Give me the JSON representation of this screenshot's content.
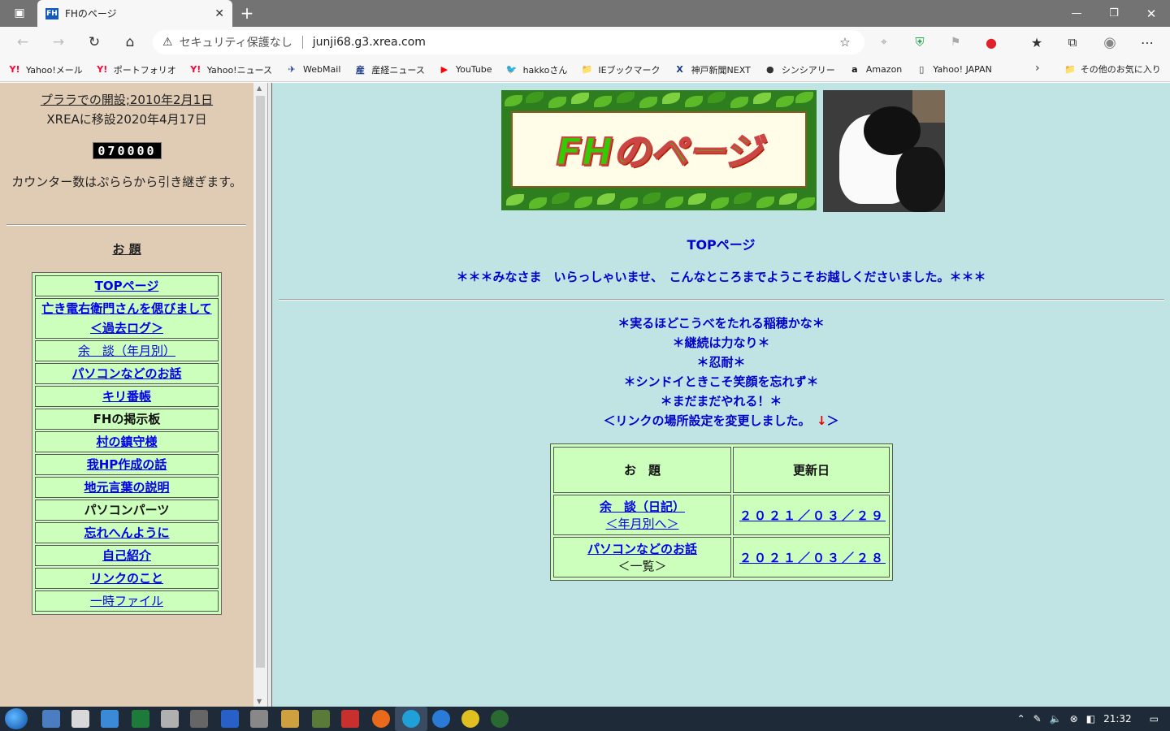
{
  "browser": {
    "tab_title": "FHのページ",
    "tab_favicon": "FH",
    "tab_close": "✕",
    "new_tab": "+",
    "security_text": "セキュリティ保護なし",
    "url": "junji68.g3.xrea.com",
    "bookmarks": [
      {
        "icon": "Y!",
        "color": "#ff0033",
        "label": "Yahoo!メール"
      },
      {
        "icon": "Y!",
        "color": "#ff0033",
        "label": "ポートフォリオ"
      },
      {
        "icon": "Y!",
        "color": "#ff0033",
        "label": "Yahoo!ニュース"
      },
      {
        "icon": "✈",
        "color": "#1a3a8a",
        "label": "WebMail"
      },
      {
        "icon": "産",
        "color": "#1a3a8a",
        "label": "産経ニュース"
      },
      {
        "icon": "▶",
        "color": "#ff0000",
        "label": "YouTube"
      },
      {
        "icon": "🐦",
        "color": "#1da1f2",
        "label": "hakkoさん"
      },
      {
        "icon": "📁",
        "color": "#e8b84a",
        "label": "IEブックマーク"
      },
      {
        "icon": "X",
        "color": "#1a3a8a",
        "label": "神戸新聞NEXT"
      },
      {
        "icon": "●",
        "color": "#333333",
        "label": "シンシアリー"
      },
      {
        "icon": "a",
        "color": "#111111",
        "label": "Amazon"
      },
      {
        "icon": "▯",
        "color": "#333333",
        "label": "Yahoo! JAPAN"
      }
    ],
    "other_bookmarks": "その他のお気に入り"
  },
  "sidebar": {
    "opened": "プララでの開設;2010年2月1日",
    "moved": "XREAに移設2020年4月17日",
    "counter": "070000",
    "counter_note": "カウンター数はぷららから引き継ぎます。",
    "odai": "お 題",
    "menu": [
      {
        "label": "TOPページ",
        "sub": "",
        "style": "link"
      },
      {
        "label": "亡き電右衛門さんを偲びまして",
        "sub": "＜過去ログ＞",
        "style": "link"
      },
      {
        "label": "余　談（年月別）",
        "sub": "",
        "style": "link-thin"
      },
      {
        "label": "パソコンなどのお話",
        "sub": "",
        "style": "link"
      },
      {
        "label": "キリ番帳",
        "sub": "",
        "style": "link"
      },
      {
        "label": "FHの掲示板",
        "sub": "",
        "style": "plain"
      },
      {
        "label": "村の鎮守様",
        "sub": "",
        "style": "link"
      },
      {
        "label": "我HP作成の話",
        "sub": "",
        "style": "link"
      },
      {
        "label": "地元言葉の説明",
        "sub": "",
        "style": "link"
      },
      {
        "label": "パソコンパーツ",
        "sub": "",
        "style": "plain"
      },
      {
        "label": "忘れへんように",
        "sub": "",
        "style": "link"
      },
      {
        "label": "自己紹介",
        "sub": "",
        "style": "link"
      },
      {
        "label": "リンクのこと",
        "sub": "",
        "style": "link"
      },
      {
        "label": "一時ファイル",
        "sub": "",
        "style": "link-thin"
      }
    ]
  },
  "main": {
    "banner_text": "FHのページ",
    "page_title": "TOPページ",
    "welcome": "＊＊＊みなさま　いらっしゃいませ、　こんなところまでようこそお越しくださいました。＊＊＊",
    "mottos": [
      "＊実るほどこうべをたれる稲穂かな＊",
      "＊継続は力なり＊",
      "＊忍耐＊",
      "＊シンドイときこそ笑顔を忘れず＊",
      "＊まだまだやれる！＊"
    ],
    "notice_text": "＜リンクの場所設定を変更しました。　",
    "notice_arrow": "↓",
    "notice_end": "＞",
    "table": {
      "header_topic": "お　題",
      "header_date": "更新日",
      "rows": [
        {
          "topic": "余　談（日記）",
          "sub": "＜年月別へ＞",
          "sub_link": true,
          "date": "２０２１／０３／２９"
        },
        {
          "topic": "パソコンなどのお話",
          "sub": "＜一覧＞",
          "sub_link": false,
          "date": "２０２１／０３／２８"
        }
      ]
    }
  },
  "taskbar": {
    "time": "21:32"
  }
}
